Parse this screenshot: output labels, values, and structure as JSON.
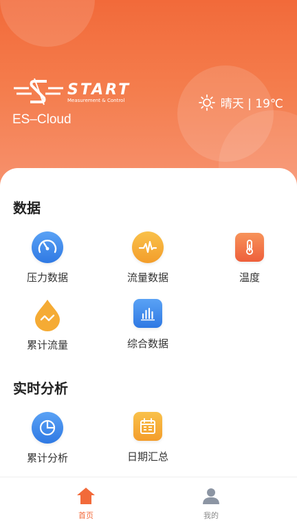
{
  "header": {
    "brand_word": "START",
    "brand_sub": "Measurement & Control",
    "app_name": "ES–Cloud",
    "weather": {
      "icon": "sun-icon",
      "text": "晴天 | 19℃"
    }
  },
  "sections": [
    {
      "title": "数据",
      "items": [
        {
          "label": "压力数据",
          "icon": "gauge-icon"
        },
        {
          "label": "流量数据",
          "icon": "pulse-icon"
        },
        {
          "label": "温度",
          "icon": "thermometer-icon"
        },
        {
          "label": "累计流量",
          "icon": "drop-icon"
        },
        {
          "label": "综合数据",
          "icon": "bar-chart-icon"
        }
      ]
    },
    {
      "title": "实时分析",
      "items": [
        {
          "label": "累计分析",
          "icon": "pie-chart-icon"
        },
        {
          "label": "日期汇总",
          "icon": "calendar-icon"
        }
      ]
    }
  ],
  "tabbar": {
    "tabs": [
      {
        "label": "首页",
        "icon": "home-icon",
        "active": true
      },
      {
        "label": "我的",
        "icon": "user-icon",
        "active": false
      }
    ]
  },
  "colors": {
    "accent": "#f26a3a",
    "blue": "#3b86e8",
    "orange": "#f3a536"
  }
}
